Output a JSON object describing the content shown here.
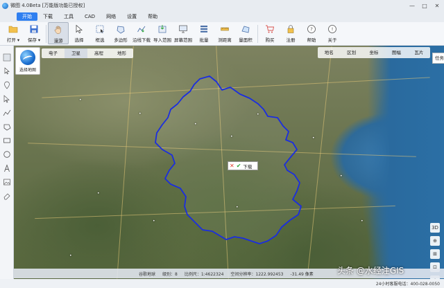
{
  "window": {
    "title": "微图 4.0Beta [万能版功能已授权]",
    "controls": [
      "—",
      "□",
      "✕"
    ]
  },
  "menu": [
    {
      "label": "开始",
      "active": true
    },
    {
      "label": "下载",
      "active": false
    },
    {
      "label": "工具",
      "active": false
    },
    {
      "label": "CAD",
      "active": false
    },
    {
      "label": "网络",
      "active": false
    },
    {
      "label": "设置",
      "active": false
    },
    {
      "label": "帮助",
      "active": false
    }
  ],
  "toolbar": [
    {
      "label": "打开 ▾",
      "icon": "folder-icon"
    },
    {
      "label": "保存 ▾",
      "icon": "save-icon"
    },
    {
      "label": "漫游",
      "icon": "hand-icon",
      "selected": true
    },
    {
      "label": "选择",
      "icon": "cursor-icon"
    },
    {
      "label": "框选",
      "icon": "box-select-icon"
    },
    {
      "label": "多边形",
      "icon": "polygon-icon"
    },
    {
      "label": "沿线下载",
      "icon": "line-download-icon"
    },
    {
      "label": "导入范围",
      "icon": "import-range-icon"
    },
    {
      "label": "屏幕范围",
      "icon": "screen-range-icon"
    },
    {
      "label": "批量",
      "icon": "batch-icon"
    },
    {
      "label": "测距离",
      "icon": "ruler-icon"
    },
    {
      "label": "量面积",
      "icon": "area-icon"
    },
    {
      "label": "购买",
      "icon": "cart-icon"
    },
    {
      "label": "注册",
      "icon": "lock-icon"
    },
    {
      "label": "帮助",
      "icon": "help-icon"
    },
    {
      "label": "关于",
      "icon": "info-icon"
    }
  ],
  "map": {
    "maptype_label": "选择地图",
    "layers": [
      {
        "label": "电子",
        "on": false
      },
      {
        "label": "卫星",
        "on": true
      },
      {
        "label": "高程",
        "on": false
      },
      {
        "label": "地形",
        "on": false
      }
    ],
    "right_tabs": [
      "地名",
      "区划",
      "坐标",
      "图幅",
      "瓦片"
    ],
    "task_list": "任务列表",
    "popup_label": "下载",
    "popup_cancel": "✕",
    "popup_ok": "✔",
    "nav": [
      "3D",
      "⊕",
      "⊞",
      "⊡",
      "+",
      "−"
    ]
  },
  "status": {
    "items": [
      "谷歌地球",
      "级别：8",
      "比例尺：1:4622324",
      "空间分辨率：1222.992453",
      "-31.49 像素"
    ]
  },
  "footer": {
    "hotline": "24小时客服电话：400-028-0050"
  },
  "watermark": "头条 @水经注GIS",
  "colors": {
    "accent": "#2f7ff0",
    "boundary": "#1a2de0"
  }
}
